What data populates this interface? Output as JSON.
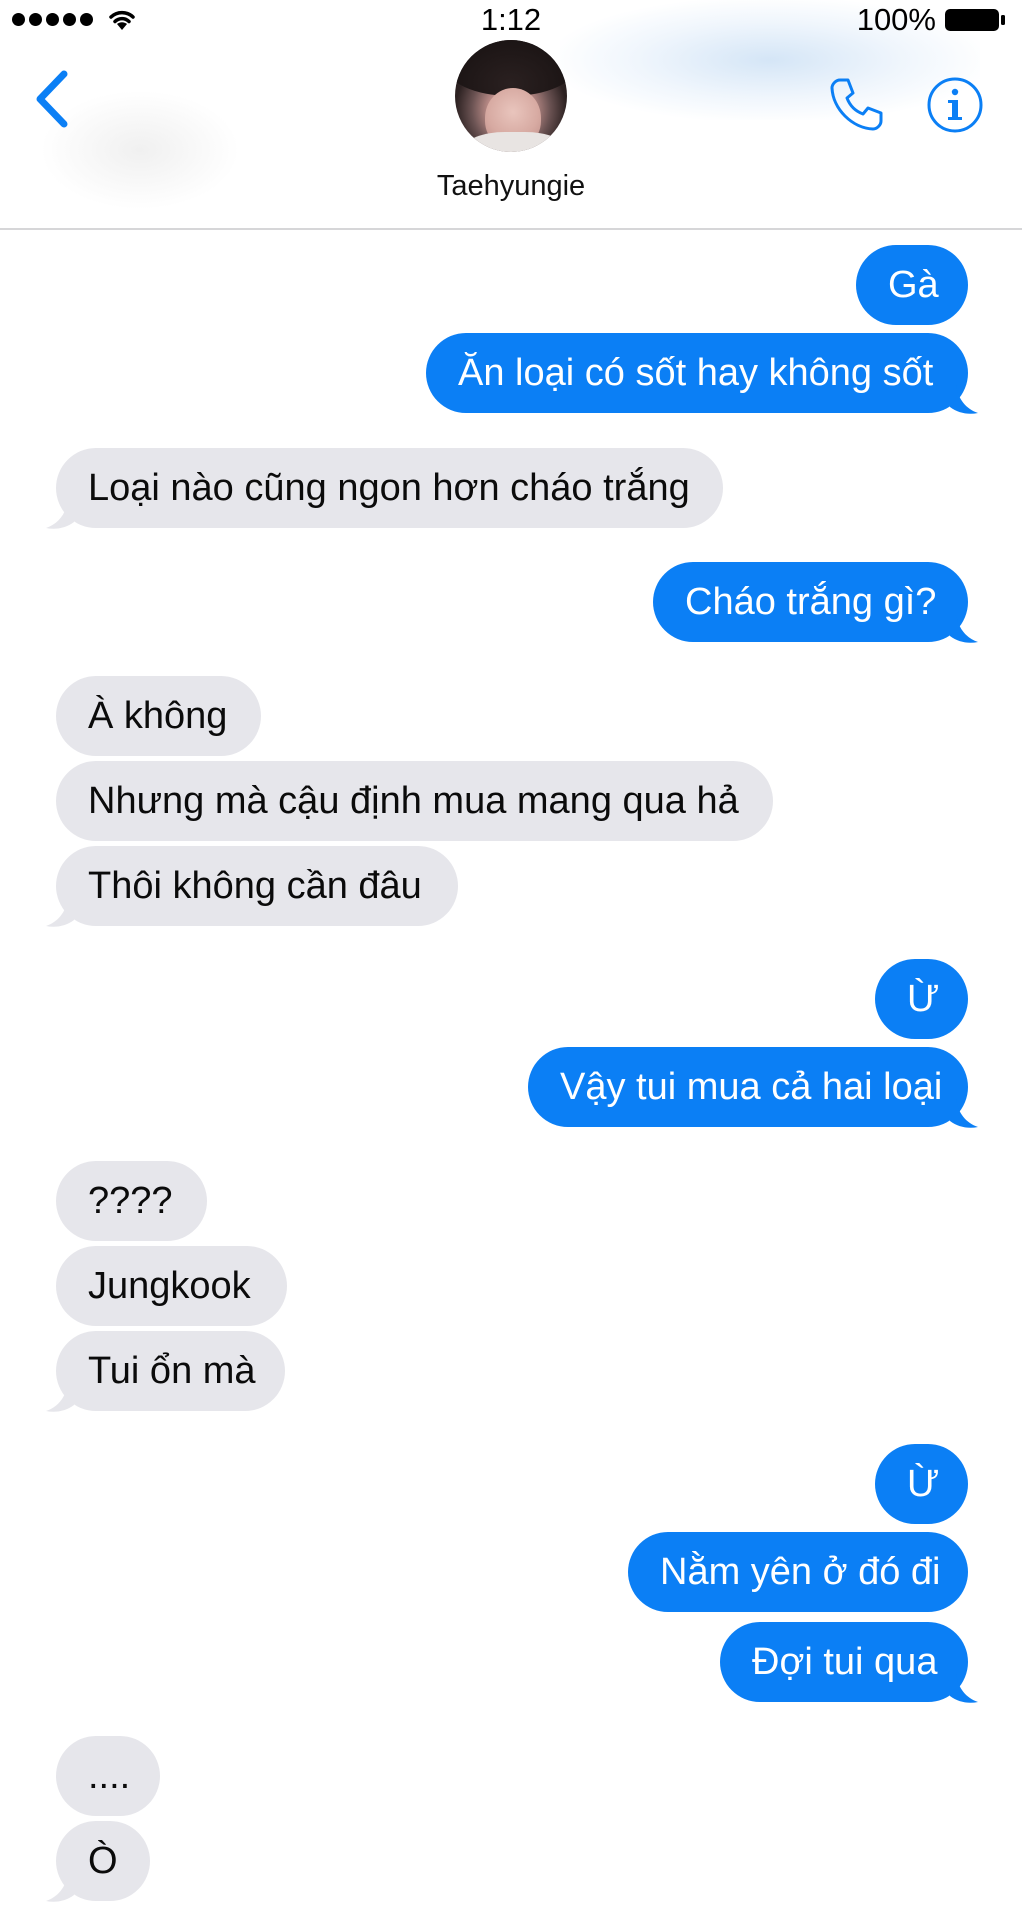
{
  "status_bar": {
    "time": "1:12",
    "battery_percent": "100%",
    "signal_icon": "signal-dots-icon",
    "wifi_icon": "wifi-icon",
    "battery_icon": "battery-icon"
  },
  "header": {
    "contact_name": "Taehyungie",
    "back_icon": "chevron-left-icon",
    "call_icon": "phone-icon",
    "info_icon": "info-icon"
  },
  "colors": {
    "accent": "#0b7ff5",
    "incoming_bubble": "#e6e6eb",
    "outgoing_text": "#ffffff"
  },
  "messages": [
    {
      "side": "out",
      "text": "Gà"
    },
    {
      "side": "out",
      "text": "Ăn loại có sốt hay không sốt"
    },
    {
      "side": "in",
      "text": "Loại nào cũng ngon hơn cháo trắng"
    },
    {
      "side": "out",
      "text": "Cháo trắng gì?"
    },
    {
      "side": "in",
      "text": "À không"
    },
    {
      "side": "in",
      "text": "Nhưng mà cậu định mua mang qua hả"
    },
    {
      "side": "in",
      "text": "Thôi không cần đâu"
    },
    {
      "side": "out",
      "text": "Ừ"
    },
    {
      "side": "out",
      "text": "Vậy tui mua cả hai loại"
    },
    {
      "side": "in",
      "text": "????"
    },
    {
      "side": "in",
      "text": "Jungkook"
    },
    {
      "side": "in",
      "text": "Tui ổn mà"
    },
    {
      "side": "out",
      "text": "Ừ"
    },
    {
      "side": "out",
      "text": "Nằm yên ở đó đi"
    },
    {
      "side": "out",
      "text": "Đợi tui qua"
    },
    {
      "side": "in",
      "text": "...."
    },
    {
      "side": "in",
      "text": "Ò"
    }
  ]
}
